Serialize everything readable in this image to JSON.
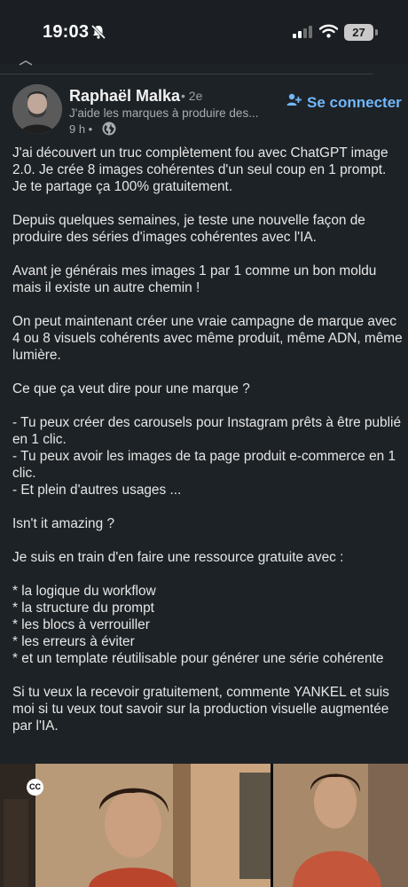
{
  "status_bar": {
    "time": "19:03",
    "battery": "27",
    "icons": [
      "bell-muted-icon",
      "cellular-signal-icon",
      "wifi-icon",
      "battery-icon"
    ]
  },
  "post": {
    "author": {
      "name": "Raphaël Malka",
      "degree": "• 2e",
      "headline": "J'aide les marques à produire des...",
      "time": "9 h •"
    },
    "connect_label": "Se connecter",
    "body": [
      "J'ai découvert un truc complètement fou avec ChatGPT image 2.0. Je crée 8 images cohérentes d'un seul coup en 1 prompt. Je te partage ça 100% gratuitement.",
      "",
      "Depuis quelques semaines, je teste une nouvelle façon de produire des séries d'images cohérentes avec l'IA.",
      "",
      "Avant je générais mes images 1 par 1 comme un bon moldu mais il existe un autre chemin !",
      "",
      "On peut maintenant créer une vraie campagne de marque avec 4 ou 8 visuels cohérents avec même produit, même ADN, même lumière.",
      "",
      "Ce que ça veut dire pour une marque ?",
      "",
      "- Tu peux créer des carousels pour Instagram prêts à être publié en 1 clic.",
      "- Tu peux avoir les images de ta page produit e-commerce en 1 clic.",
      "- Et plein d'autres usages ...",
      "",
      "Isn't it amazing ?",
      "",
      "Je suis en train d'en faire une ressource gratuite avec :",
      "",
      "* la logique du workflow",
      "* la structure du prompt",
      "* les blocs à verrouiller",
      "* les erreurs à éviter",
      "* et un template réutilisable pour générer une série cohérente",
      "",
      "Si tu veux la recevoir gratuitement, commente YANKEL et suis moi si tu veux tout savoir sur la production visuelle augmentée par l'IA."
    ],
    "media_badge": "CC"
  }
}
